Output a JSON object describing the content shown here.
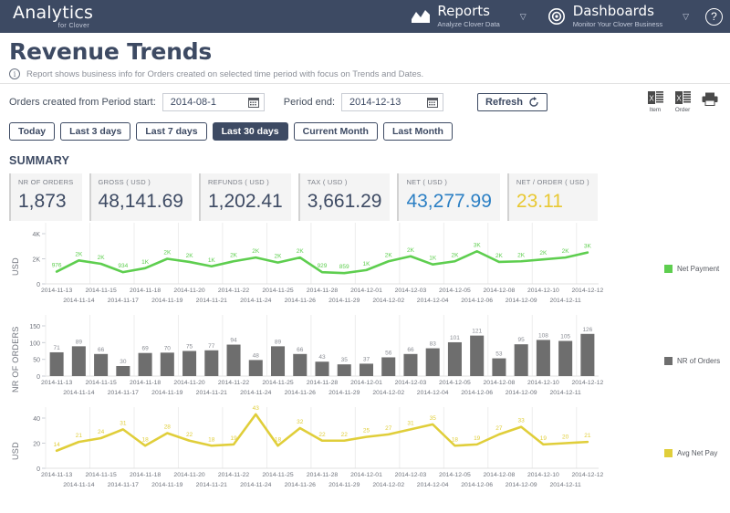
{
  "header": {
    "brand_title": "Analytics",
    "brand_sub": "for Clover",
    "nav": [
      {
        "label": "Reports",
        "sub": "Analyze Clover Data",
        "icon": "chart-line-icon",
        "caret": "▽"
      },
      {
        "label": "Dashboards",
        "sub": "Monitor Your Clover Business",
        "icon": "target-icon",
        "caret": "▽"
      }
    ],
    "help_label": "?"
  },
  "page": {
    "title": "Revenue Trends",
    "info_text": "Report shows business info for Orders created on selected time period with focus on Trends and Dates."
  },
  "filters": {
    "start_label": "Orders created from Period start:",
    "start_value": "2014-08-1",
    "end_label": "Period end:",
    "end_value": "2014-12-13",
    "refresh_label": "Refresh",
    "export_item_label": "Item",
    "export_order_label": "Order"
  },
  "period_tabs": [
    {
      "label": "Today",
      "active": false
    },
    {
      "label": "Last 3 days",
      "active": false
    },
    {
      "label": "Last 7 days",
      "active": false
    },
    {
      "label": "Last 30 days",
      "active": true
    },
    {
      "label": "Current Month",
      "active": false
    },
    {
      "label": "Last Month",
      "active": false
    }
  ],
  "summary": {
    "heading": "SUMMARY",
    "cards": [
      {
        "label": "NR OF ORDERS",
        "value": "1,873",
        "style": "default"
      },
      {
        "label": "GROSS ( USD )",
        "value": "48,141.69",
        "style": "default"
      },
      {
        "label": "REFUNDS ( USD )",
        "value": "1,202.41",
        "style": "default"
      },
      {
        "label": "TAX ( USD )",
        "value": "3,661.29",
        "style": "default"
      },
      {
        "label": "NET ( USD )",
        "value": "43,277.99",
        "style": "net"
      },
      {
        "label": "NET / ORDER ( USD )",
        "value": "23.11",
        "style": "netorder"
      }
    ]
  },
  "colors": {
    "navy": "#3d4a63",
    "net_payment": "#5ece4f",
    "nr_orders": "#6e6e6e",
    "avg_net_pay": "#e0ce3a",
    "net_value": "#2b7fc4",
    "net_order_value": "#e8c832"
  },
  "chart_data": [
    {
      "type": "line",
      "name": "net-payment-chart",
      "title": "",
      "ylabel": "USD",
      "legend": "Net Payment",
      "legend_position": "right",
      "color": "#5ece4f",
      "grid": true,
      "ylim": [
        0,
        4000
      ],
      "yticks": [
        0,
        2000,
        4000
      ],
      "ytick_labels": [
        "0",
        "2K",
        "4K"
      ],
      "x": [
        "2014-11-13",
        "2014-11-14",
        "2014-11-15",
        "2014-11-17",
        "2014-11-18",
        "2014-11-19",
        "2014-11-20",
        "2014-11-21",
        "2014-11-22",
        "2014-11-24",
        "2014-11-25",
        "2014-11-26",
        "2014-11-28",
        "2014-11-29",
        "2014-12-01",
        "2014-12-02",
        "2014-12-03",
        "2014-12-04",
        "2014-12-05",
        "2014-12-06",
        "2014-12-08",
        "2014-12-09",
        "2014-12-10",
        "2014-12-11",
        "2014-12-12"
      ],
      "values": [
        976,
        1870,
        1600,
        934,
        1250,
        2000,
        1750,
        1400,
        1800,
        2100,
        1700,
        2100,
        929,
        859,
        1100,
        1800,
        2200,
        1550,
        1800,
        2600,
        1750,
        1800,
        1950,
        2100,
        2500
      ],
      "labels": [
        "976",
        "2K",
        "2K",
        "934",
        "1K",
        "2K",
        "2K",
        "1K",
        "2K",
        "2K",
        "2K",
        "2K",
        "929",
        "859",
        "1K",
        "2K",
        "2K",
        "1K",
        "2K",
        "3K",
        "2K",
        "2K",
        "2K",
        "2K",
        "3K"
      ]
    },
    {
      "type": "bar",
      "name": "nr-of-orders-chart",
      "title": "",
      "ylabel": "NR OF ORDERS",
      "legend": "NR of Orders",
      "legend_position": "right",
      "color": "#6e6e6e",
      "grid": true,
      "ylim": [
        0,
        150
      ],
      "yticks": [
        0,
        50,
        100,
        150
      ],
      "ytick_labels": [
        "0",
        "50",
        "100",
        "150"
      ],
      "categories": [
        "2014-11-13",
        "2014-11-14",
        "2014-11-15",
        "2014-11-17",
        "2014-11-18",
        "2014-11-19",
        "2014-11-20",
        "2014-11-21",
        "2014-11-22",
        "2014-11-24",
        "2014-11-25",
        "2014-11-26",
        "2014-11-28",
        "2014-11-29",
        "2014-12-01",
        "2014-12-02",
        "2014-12-03",
        "2014-12-04",
        "2014-12-05",
        "2014-12-06",
        "2014-12-08",
        "2014-12-09",
        "2014-12-10",
        "2014-12-11",
        "2014-12-12"
      ],
      "values": [
        71,
        89,
        66,
        30,
        69,
        70,
        75,
        77,
        94,
        48,
        89,
        66,
        43,
        35,
        37,
        56,
        66,
        83,
        101,
        121,
        53,
        95,
        108,
        105,
        126
      ],
      "labels": [
        "71",
        "89",
        "66",
        "30",
        "69",
        "70",
        "75",
        "77",
        "94",
        "48",
        "89",
        "66",
        "43",
        "35",
        "37",
        "56",
        "66",
        "83",
        "101",
        "121",
        "53",
        "95",
        "108",
        "105",
        "126"
      ]
    },
    {
      "type": "line",
      "name": "avg-net-pay-chart",
      "title": "",
      "ylabel": "USD",
      "legend": "Avg Net Pay",
      "legend_position": "right",
      "color": "#e0ce3a",
      "grid": true,
      "ylim": [
        0,
        40
      ],
      "yticks": [
        0,
        20,
        40
      ],
      "ytick_labels": [
        "0",
        "20",
        "40"
      ],
      "x": [
        "2014-11-13",
        "2014-11-14",
        "2014-11-15",
        "2014-11-17",
        "2014-11-18",
        "2014-11-19",
        "2014-11-20",
        "2014-11-21",
        "2014-11-22",
        "2014-11-24",
        "2014-11-25",
        "2014-11-26",
        "2014-11-28",
        "2014-11-29",
        "2014-12-01",
        "2014-12-02",
        "2014-12-03",
        "2014-12-04",
        "2014-12-05",
        "2014-12-06",
        "2014-12-08",
        "2014-12-09",
        "2014-12-10",
        "2014-12-11",
        "2014-12-12"
      ],
      "values": [
        14,
        21,
        24,
        31,
        18,
        28,
        22,
        18,
        19,
        43,
        18,
        32,
        22,
        22,
        25,
        27,
        31,
        35,
        18,
        19,
        27,
        33,
        19,
        20,
        21
      ],
      "labels": [
        "14",
        "21",
        "24",
        "31",
        "18",
        "28",
        "22",
        "18",
        "19",
        "43",
        "18",
        "32",
        "22",
        "22",
        "25",
        "27",
        "31",
        "35",
        "18",
        "19",
        "27",
        "33",
        "19",
        "20",
        "21"
      ]
    }
  ]
}
